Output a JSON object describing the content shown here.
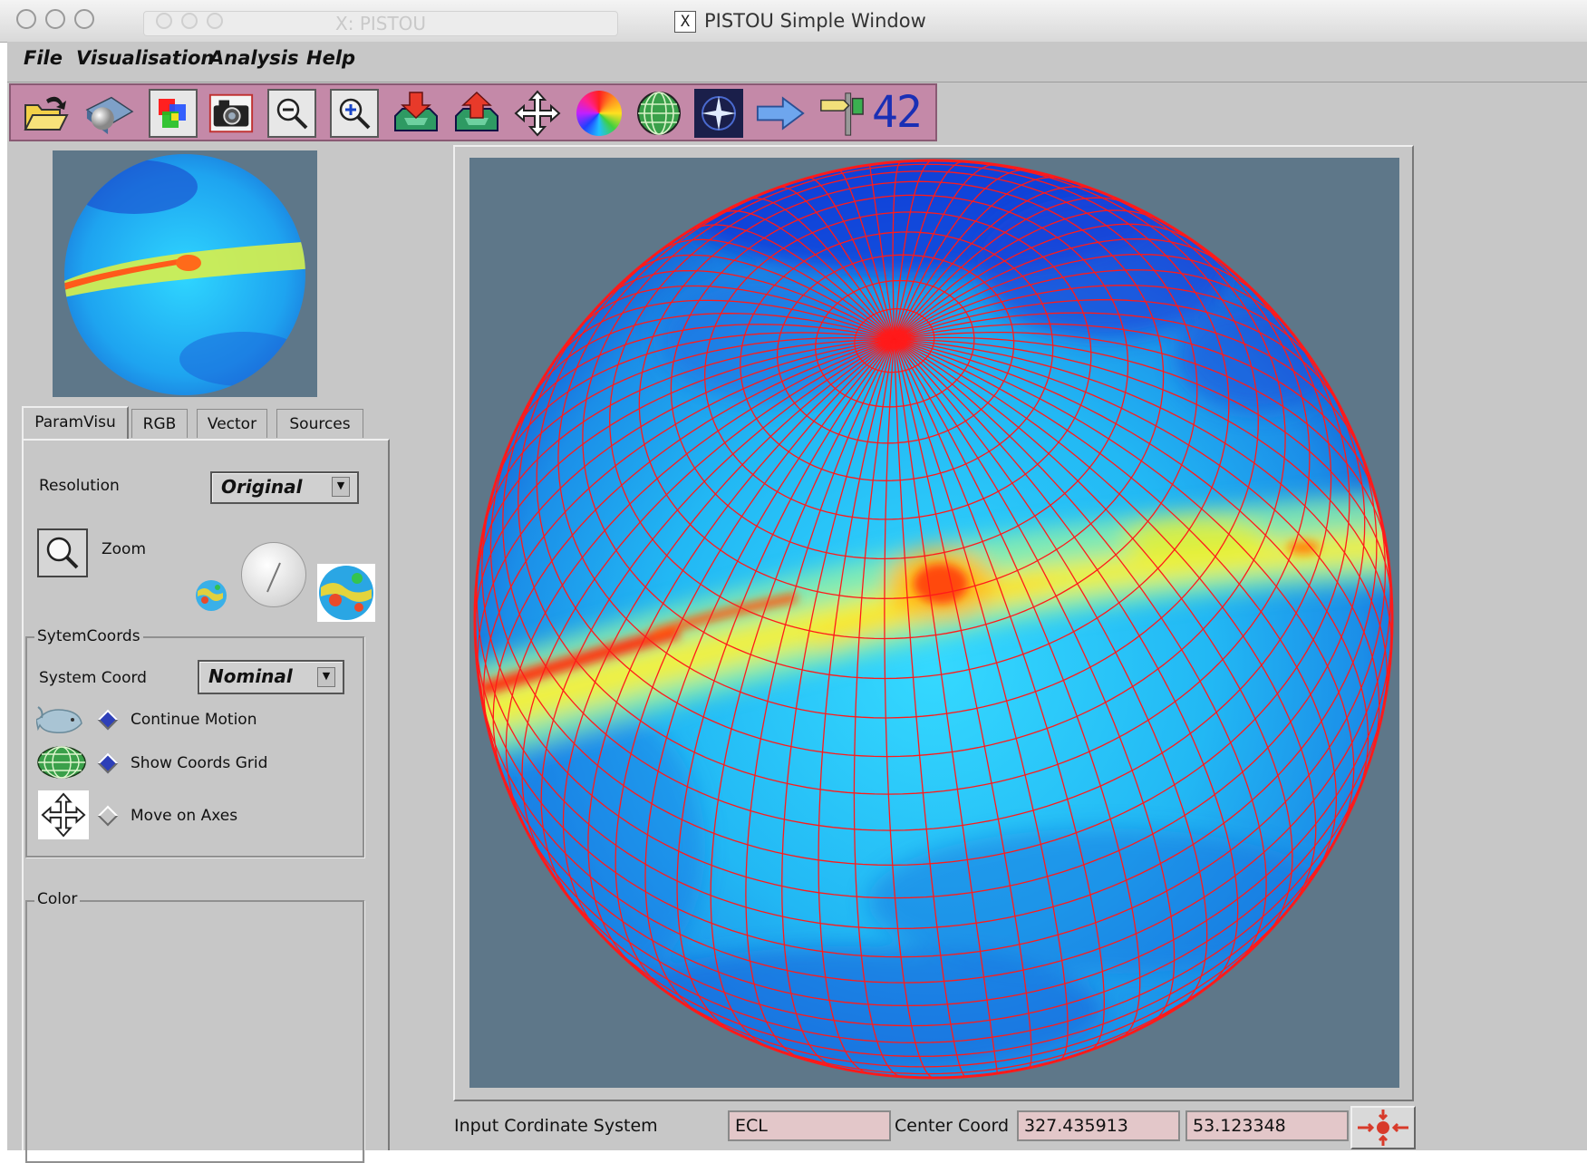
{
  "window": {
    "title": "PISTOU Simple Window",
    "background_title": "PISTOU",
    "x_logo": "X"
  },
  "menu": {
    "file": "File",
    "visualisation": "Visualisation",
    "analysis": "Analysis",
    "help": "Help"
  },
  "toolbar": {
    "icons": [
      "open-folder-icon",
      "sphere-on-plane-icon",
      "rgb-squares-icon",
      "camera-icon",
      "zoom-out-icon",
      "zoom-in-icon",
      "download-tray-icon",
      "upload-tray-icon",
      "move-arrows-icon",
      "color-wheel-icon",
      "globe-grid-icon",
      "star-point-icon",
      "right-arrow-icon",
      "signpost-icon"
    ],
    "counter": "42",
    "colors": {
      "bar": "#c489a8"
    }
  },
  "tabs": [
    "ParamVisu",
    "RGB",
    "Vector",
    "Sources"
  ],
  "param_visu": {
    "resolution_label": "Resolution",
    "resolution_value": "Original",
    "zoom_label": "Zoom",
    "system_coords_group": "SytemCoords",
    "system_coord_label": "System Coord",
    "system_coord_value": "Nominal",
    "options": [
      {
        "label": "Continue Motion",
        "selected": true,
        "icon": "whale-icon"
      },
      {
        "label": "Show Coords Grid",
        "selected": true,
        "icon": "globe-grid-icon"
      },
      {
        "label": "Move on Axes",
        "selected": false,
        "icon": "move-arrows-icon"
      }
    ],
    "color_group": "Color"
  },
  "coordinates": {
    "input_label": "Input Cordinate System",
    "input_value": "ECL",
    "center_label": "Center Coord",
    "center_lon": "327.435913",
    "center_lat": "53.123348"
  },
  "colors": {
    "sphere_background": "#5e7789",
    "grid": "#ff1a1a",
    "panel": "#c7c7c7",
    "field": "#e3c7c9"
  }
}
